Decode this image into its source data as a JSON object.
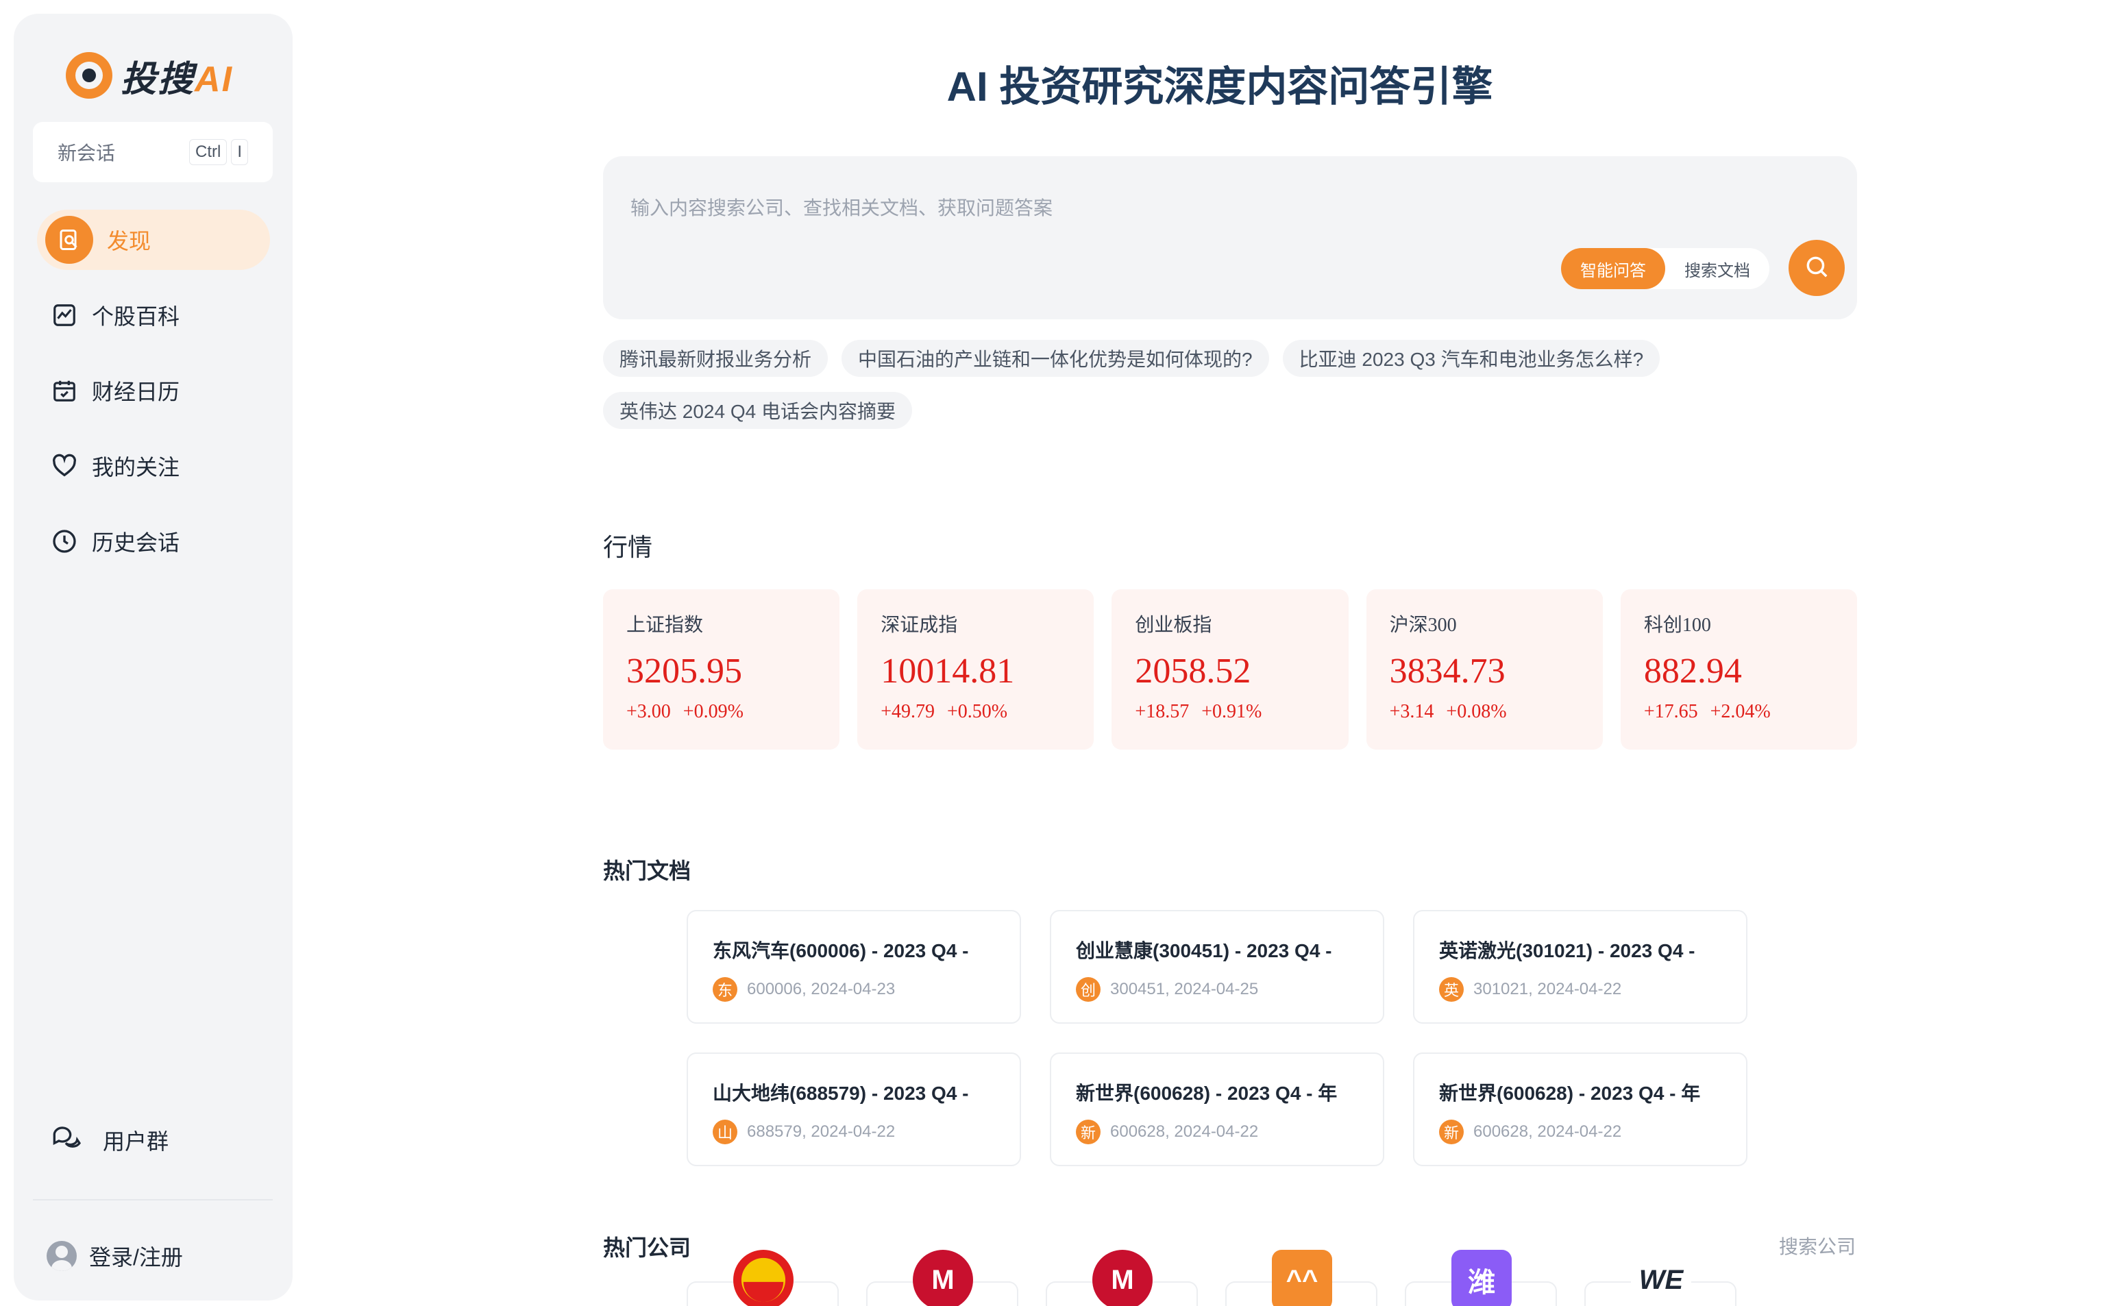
{
  "sidebar": {
    "logo_text": "投搜",
    "logo_ai": "AI",
    "new_chat_label": "新会话",
    "shortcut_keys": [
      "Ctrl",
      "I"
    ],
    "nav": [
      {
        "label": "发现",
        "icon": "discover-icon",
        "active": true
      },
      {
        "label": "个股百科",
        "icon": "stock-chart-icon"
      },
      {
        "label": "财经日历",
        "icon": "calendar-icon"
      },
      {
        "label": "我的关注",
        "icon": "heart-icon"
      },
      {
        "label": "历史会话",
        "icon": "clock-icon"
      }
    ],
    "user_group_label": "用户群",
    "login_label": "登录/注册"
  },
  "main": {
    "title": "AI 投资研究深度内容问答引擎",
    "search": {
      "placeholder": "输入内容搜索公司、查找相关文档、获取问题答案",
      "value": "",
      "modes": [
        "智能问答",
        "搜索文档"
      ],
      "active_mode": "智能问答"
    },
    "suggestions": [
      "腾讯最新财报业务分析",
      "中国石油的产业链和一体化优势是如何体现的?",
      "比亚迪 2023 Q3 汽车和电池业务怎么样?",
      "英伟达 2024 Q4 电话会内容摘要"
    ],
    "market_title": "行情",
    "market": [
      {
        "name": "上证指数",
        "value": "3205.95",
        "change": "+3.00",
        "pct": "+0.09%"
      },
      {
        "name": "深证成指",
        "value": "10014.81",
        "change": "+49.79",
        "pct": "+0.50%"
      },
      {
        "name": "创业板指",
        "value": "2058.52",
        "change": "+18.57",
        "pct": "+0.91%"
      },
      {
        "name": "沪深300",
        "value": "3834.73",
        "change": "+3.14",
        "pct": "+0.08%"
      },
      {
        "name": "科创100",
        "value": "882.94",
        "change": "+17.65",
        "pct": "+2.04%"
      }
    ],
    "hot_docs_title": "热门文档",
    "hot_docs": [
      {
        "title": "东风汽车(600006) - 2023 Q4 -",
        "badge": "东",
        "meta": "600006, 2024-04-23"
      },
      {
        "title": "创业慧康(300451) - 2023 Q4 -",
        "badge": "创",
        "meta": "300451, 2024-04-25"
      },
      {
        "title": "英诺激光(301021) - 2023 Q4 -",
        "badge": "英",
        "meta": "301021, 2024-04-22"
      },
      {
        "title": "山大地纬(688579) - 2023 Q4 -",
        "badge": "山",
        "meta": "688579, 2024-04-22"
      },
      {
        "title": "新世界(600628) - 2023 Q4 - 年",
        "badge": "新",
        "meta": "600628, 2024-04-22"
      },
      {
        "title": "新世界(600628) - 2023 Q4 - 年",
        "badge": "新",
        "meta": "600628, 2024-04-22"
      }
    ],
    "hot_companies_title": "热门公司",
    "search_company_label": "搜索公司",
    "companies": [
      {
        "logo": "",
        "color": "#e11d1d",
        "shape": "round"
      },
      {
        "logo": "M",
        "color": "#c8102e",
        "shape": "round"
      },
      {
        "logo": "M",
        "color": "#c8102e",
        "shape": "round"
      },
      {
        "logo": "^^",
        "color": "#f38b2d",
        "shape": "square"
      },
      {
        "logo": "潍",
        "color": "#8b5cf6",
        "shape": "square"
      },
      {
        "logo": "WE",
        "color": "#1f2937",
        "shape": "square"
      }
    ],
    "colors": {
      "accent": "#f38b2d",
      "up": "#e0201b",
      "title": "#1f3a5a"
    }
  }
}
